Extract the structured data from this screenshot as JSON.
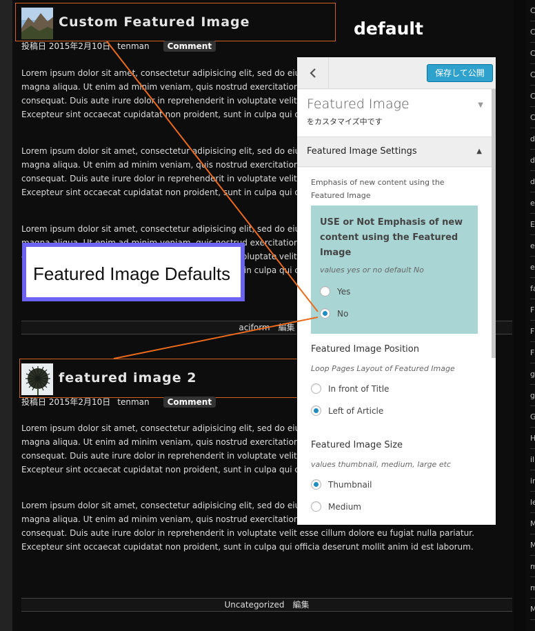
{
  "posts": [
    {
      "title": "Custom Featured Image",
      "meta_date": "投稿日 2015年2月10日",
      "meta_author": "tenman",
      "comment": "Comment",
      "paragraphs": [
        "Lorem ipsum dolor sit amet, consectetur adipisicing elit, sed do eiusmod tempor incididunt ut labore et dolore magna aliqua. Ut enim ad minim veniam, quis nostrud exercitation ullamco laboris nisi ut aliquip ex ea commodo consequat. Duis aute irure dolor in reprehenderit in voluptate velit esse cillum dolore eu fugiat nulla pariatur. Excepteur sint occaecat cupidatat non proident, sunt in culpa qui officia deserunt mollit anim id est laborum.",
        "Lorem ipsum dolor sit amet, consectetur adipisicing elit, sed do eiusmod tempor incididunt ut labore et dolore magna aliqua. Ut enim ad minim veniam, quis nostrud exercitation ullamco laboris nisi ut aliquip ex ea commodo consequat. Duis aute irure dolor in reprehenderit in voluptate velit esse cillum dolore eu fugiat nulla pariatur. Excepteur sint occaecat cupidatat non proident, sunt in culpa qui officia deserunt mollit anim id est laborum.",
        "Lorem ipsum dolor sit amet, consectetur adipisicing elit, sed do eiusmod tempor incididunt ut labore et dolore magna aliqua. Ut enim ad minim veniam, quis nostrud exercitation ullamco laboris nisi ut aliquip ex ea commodo consequat. Duis aute irure dolor in reprehenderit in voluptate velit esse cillum dolore eu fugiat nulla pariatur. Excepteur sint occaecat cupidatat non proident, sunt in culpa qui officia deserunt mollit anim id est laborum."
      ],
      "footer": "aciform　編集"
    },
    {
      "title": "featured image 2",
      "meta_date": "投稿日 2015年2月10日",
      "meta_author": "tenman",
      "comment": "Comment",
      "paragraphs": [
        "Lorem ipsum dolor sit amet, consectetur adipisicing elit, sed do eiusmod tempor incididunt ut labore et dolore magna aliqua. Ut enim ad minim veniam, quis nostrud exercitation ullamco laboris nisi ut aliquip ex ea commodo consequat. Duis aute irure dolor in reprehenderit in voluptate velit esse cillum dolore eu fugiat nulla pariatur. Excepteur sint occaecat cupidatat non proident, sunt in culpa qui officia deserunt mollit anim id est laborum.",
        "Lorem ipsum dolor sit amet, consectetur adipisicing elit, sed do eiusmod tempor incididunt ut labore et dolore magna aliqua. Ut enim ad minim veniam, quis nostrud exercitation ullamco laboris nisi ut aliquip ex ea commodo consequat. Duis aute irure dolor in reprehenderit in voluptate velit esse cillum dolore eu fugiat nulla pariatur. Excepteur sint occaecat cupidatat non proident, sunt in culpa qui officia deserunt mollit anim id est laborum."
      ],
      "footer": "Uncategorized　編集"
    }
  ],
  "annotations": {
    "default_label": "default",
    "defaults_box": "Featured Image Defaults"
  },
  "panel": {
    "back_icon": "chevron-left-icon",
    "publish": "保存して公開",
    "section_title": "Featured Image",
    "section_sub": "をカスタマイズ中です",
    "settings_title": "Featured Image Settings",
    "emphasis_desc": "Emphasis of new content using the Featured Image",
    "emphasis_title": "USE or Not Emphasis of new content using the Featured Image",
    "emphasis_note": "values yes or no default No",
    "emphasis_options": [
      "Yes",
      "No"
    ],
    "emphasis_selected": "No",
    "position_title": "Featured Image Position",
    "position_note": "Loop Pages Layout of Featured Image",
    "position_options": [
      "In front of Title",
      "Left of Article"
    ],
    "position_selected": "Left of Article",
    "size_title": "Featured Image Size",
    "size_note": "values thumbnail, medium, large etc",
    "size_options": [
      "Thumbnail",
      "Medium"
    ],
    "size_selected": "Thumbnail"
  },
  "sidebar_letters": [
    "C",
    "C",
    "C",
    "C",
    "C",
    "C",
    "d",
    "d",
    "d",
    "e",
    "E",
    "e",
    "e",
    "fa",
    "F",
    "F",
    "F",
    "g",
    "g",
    "G",
    "H",
    "il",
    "in",
    "le",
    "M",
    "M",
    "m",
    "m",
    "M"
  ],
  "colors": {
    "annotation_orange": "#d5621f",
    "defaults_border": "#6c63f2",
    "teal": "#a9d6d4",
    "publish_blue": "#2ea2cc"
  }
}
